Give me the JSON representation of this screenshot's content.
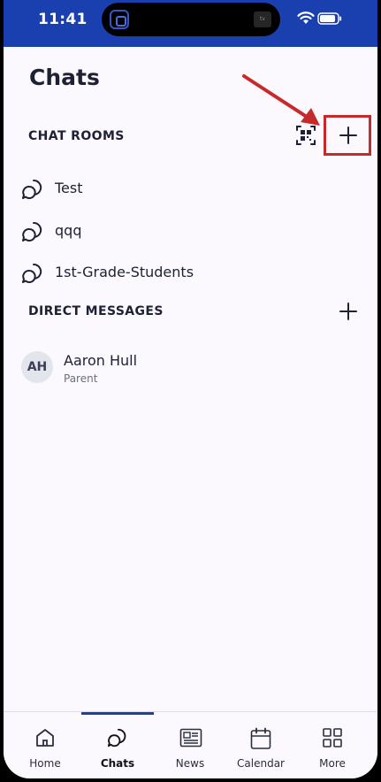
{
  "status_bar": {
    "time": "11:41",
    "island_badge": "tv"
  },
  "header": {
    "title": "Chats"
  },
  "chat_rooms": {
    "header": "CHAT ROOMS",
    "items": [
      {
        "label": "Test"
      },
      {
        "label": "qqq"
      },
      {
        "label": "1st-Grade-Students"
      }
    ]
  },
  "direct_messages": {
    "header": "DIRECT MESSAGES",
    "items": [
      {
        "initials": "AH",
        "name": "Aaron Hull",
        "role": "Parent"
      }
    ]
  },
  "tab_bar": {
    "tabs": [
      {
        "label": "Home",
        "icon": "home-icon"
      },
      {
        "label": "Chats",
        "icon": "chat-bubble-icon",
        "active": true
      },
      {
        "label": "News",
        "icon": "newspaper-icon"
      },
      {
        "label": "Calendar",
        "icon": "calendar-icon"
      },
      {
        "label": "More",
        "icon": "grid-icon"
      }
    ]
  },
  "colors": {
    "accent": "#1a3fae",
    "annotation": "#c62a2a",
    "background": "#fbf9fd",
    "text": "#1e2133"
  }
}
